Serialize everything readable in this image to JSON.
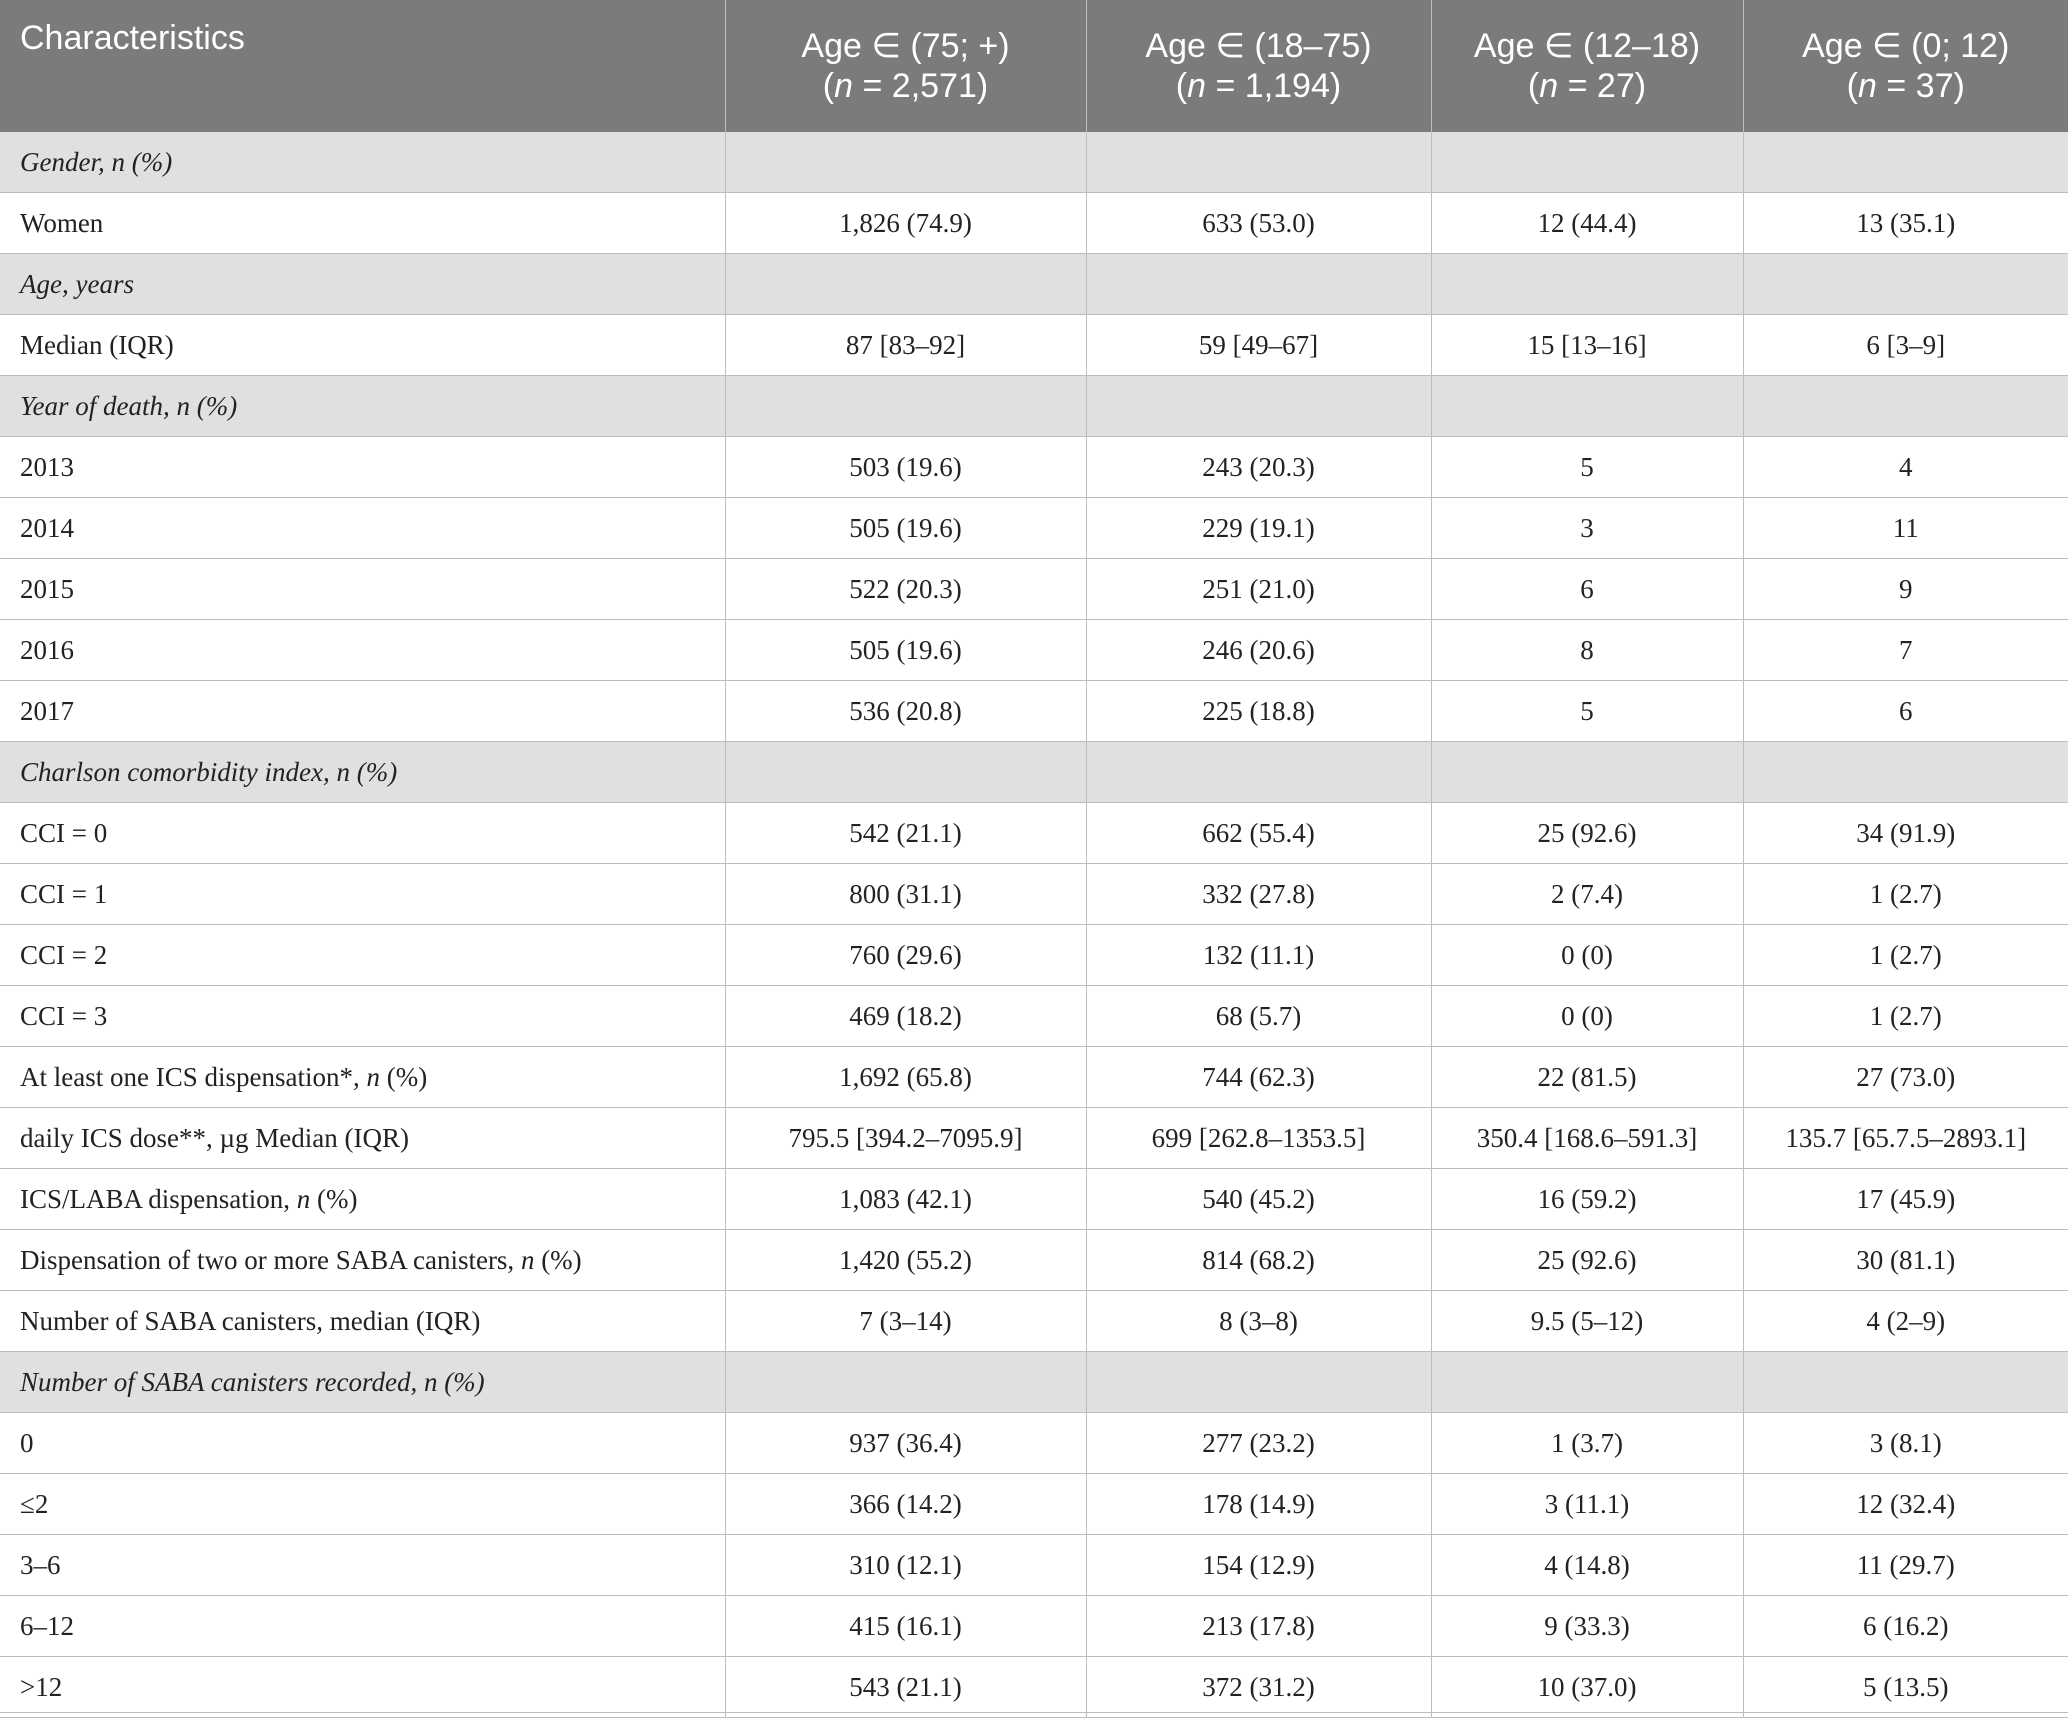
{
  "header": {
    "characteristics": "Characteristics",
    "columns": [
      {
        "age": "Age ∈ (75; +)",
        "n_label": "n",
        "n_value": " = 2,571)"
      },
      {
        "age": "Age ∈ (18–75)",
        "n_label": "n",
        "n_value": " = 1,194)"
      },
      {
        "age": "Age ∈ (12–18)",
        "n_label": "n",
        "n_value": " = 27)"
      },
      {
        "age": "Age ∈ (0; 12)",
        "n_label": "n",
        "n_value": " = 37)"
      }
    ],
    "open_paren": "("
  },
  "rows": [
    {
      "type": "section",
      "label_pre": "Gender, n (%)",
      "label_it": "",
      "label_post": "",
      "values": [
        "",
        "",
        "",
        ""
      ]
    },
    {
      "type": "data",
      "label_pre": "Women",
      "label_it": "",
      "label_post": "",
      "values": [
        "1,826 (74.9)",
        "633 (53.0)",
        "12 (44.4)",
        "13 (35.1)"
      ]
    },
    {
      "type": "section",
      "label_pre": "Age, years",
      "label_it": "",
      "label_post": "",
      "values": [
        "",
        "",
        "",
        ""
      ]
    },
    {
      "type": "data",
      "label_pre": "Median (IQR)",
      "label_it": "",
      "label_post": "",
      "values": [
        "87 [83–92]",
        "59 [49–67]",
        "15 [13–16]",
        "6 [3–9]"
      ]
    },
    {
      "type": "section",
      "label_pre": "Year of death, n (%)",
      "label_it": "",
      "label_post": "",
      "values": [
        "",
        "",
        "",
        ""
      ]
    },
    {
      "type": "data",
      "label_pre": "2013",
      "label_it": "",
      "label_post": "",
      "values": [
        "503 (19.6)",
        "243 (20.3)",
        "5",
        "4"
      ]
    },
    {
      "type": "data",
      "label_pre": "2014",
      "label_it": "",
      "label_post": "",
      "values": [
        "505 (19.6)",
        "229 (19.1)",
        "3",
        "11"
      ]
    },
    {
      "type": "data",
      "label_pre": "2015",
      "label_it": "",
      "label_post": "",
      "values": [
        "522 (20.3)",
        "251 (21.0)",
        "6",
        "9"
      ]
    },
    {
      "type": "data",
      "label_pre": "2016",
      "label_it": "",
      "label_post": "",
      "values": [
        "505 (19.6)",
        "246 (20.6)",
        "8",
        "7"
      ]
    },
    {
      "type": "data",
      "label_pre": "2017",
      "label_it": "",
      "label_post": "",
      "values": [
        "536 (20.8)",
        "225 (18.8)",
        "5",
        "6"
      ]
    },
    {
      "type": "section",
      "label_pre": "Charlson comorbidity index, n (%)",
      "label_it": "",
      "label_post": "",
      "values": [
        "",
        "",
        "",
        ""
      ]
    },
    {
      "type": "data",
      "label_pre": "CCI = 0",
      "label_it": "",
      "label_post": "",
      "values": [
        "542 (21.1)",
        "662 (55.4)",
        "25 (92.6)",
        "34 (91.9)"
      ]
    },
    {
      "type": "data",
      "label_pre": "CCI = 1",
      "label_it": "",
      "label_post": "",
      "values": [
        "800 (31.1)",
        "332 (27.8)",
        "2 (7.4)",
        "1 (2.7)"
      ]
    },
    {
      "type": "data",
      "label_pre": "CCI = 2",
      "label_it": "",
      "label_post": "",
      "values": [
        "760 (29.6)",
        "132 (11.1)",
        "0 (0)",
        "1 (2.7)"
      ]
    },
    {
      "type": "data",
      "label_pre": "CCI = 3",
      "label_it": "",
      "label_post": "",
      "values": [
        "469 (18.2)",
        "68 (5.7)",
        "0 (0)",
        "1 (2.7)"
      ]
    },
    {
      "type": "data",
      "label_pre": "At least one ICS dispensation*, ",
      "label_it": "n",
      "label_post": " (%)",
      "values": [
        "1,692 (65.8)",
        "744 (62.3)",
        "22 (81.5)",
        "27 (73.0)"
      ]
    },
    {
      "type": "data",
      "label_pre": "daily ICS dose**, µg Median (IQR)",
      "label_it": "",
      "label_post": "",
      "values": [
        "795.5 [394.2–7095.9]",
        "699 [262.8–1353.5]",
        "350.4 [168.6–591.3]",
        "135.7 [65.7.5–2893.1]"
      ]
    },
    {
      "type": "data",
      "label_pre": "ICS/LABA dispensation, ",
      "label_it": "n",
      "label_post": " (%)",
      "values": [
        "1,083 (42.1)",
        "540 (45.2)",
        "16 (59.2)",
        "17 (45.9)"
      ]
    },
    {
      "type": "data",
      "label_pre": "Dispensation of two or more SABA canisters, ",
      "label_it": "n",
      "label_post": " (%)",
      "values": [
        "1,420 (55.2)",
        "814 (68.2)",
        "25 (92.6)",
        "30 (81.1)"
      ]
    },
    {
      "type": "data",
      "label_pre": "Number of SABA canisters, median (IQR)",
      "label_it": "",
      "label_post": "",
      "values": [
        "7 (3–14)",
        "8 (3–8)",
        "9.5 (5–12)",
        "4 (2–9)"
      ]
    },
    {
      "type": "section",
      "label_pre": "Number of SABA canisters recorded, n (%)",
      "label_it": "",
      "label_post": "",
      "values": [
        "",
        "",
        "",
        ""
      ]
    },
    {
      "type": "data",
      "label_pre": "0",
      "label_it": "",
      "label_post": "",
      "values": [
        "937 (36.4)",
        "277 (23.2)",
        "1 (3.7)",
        "3 (8.1)"
      ]
    },
    {
      "type": "data",
      "label_pre": "≤2",
      "label_it": "",
      "label_post": "",
      "values": [
        "366 (14.2)",
        "178 (14.9)",
        "3 (11.1)",
        "12 (32.4)"
      ]
    },
    {
      "type": "data",
      "label_pre": "3–6",
      "label_it": "",
      "label_post": "",
      "values": [
        "310 (12.1)",
        "154 (12.9)",
        "4 (14.8)",
        "11 (29.7)"
      ]
    },
    {
      "type": "data",
      "label_pre": "6–12",
      "label_it": "",
      "label_post": "",
      "values": [
        "415 (16.1)",
        "213 (17.8)",
        "9 (33.3)",
        "6 (16.2)"
      ]
    },
    {
      "type": "data",
      "label_pre": ">12",
      "label_it": "",
      "label_post": "",
      "values": [
        "543 (21.1)",
        "372 (31.2)",
        "10 (37.0)",
        "5 (13.5)"
      ]
    }
  ]
}
